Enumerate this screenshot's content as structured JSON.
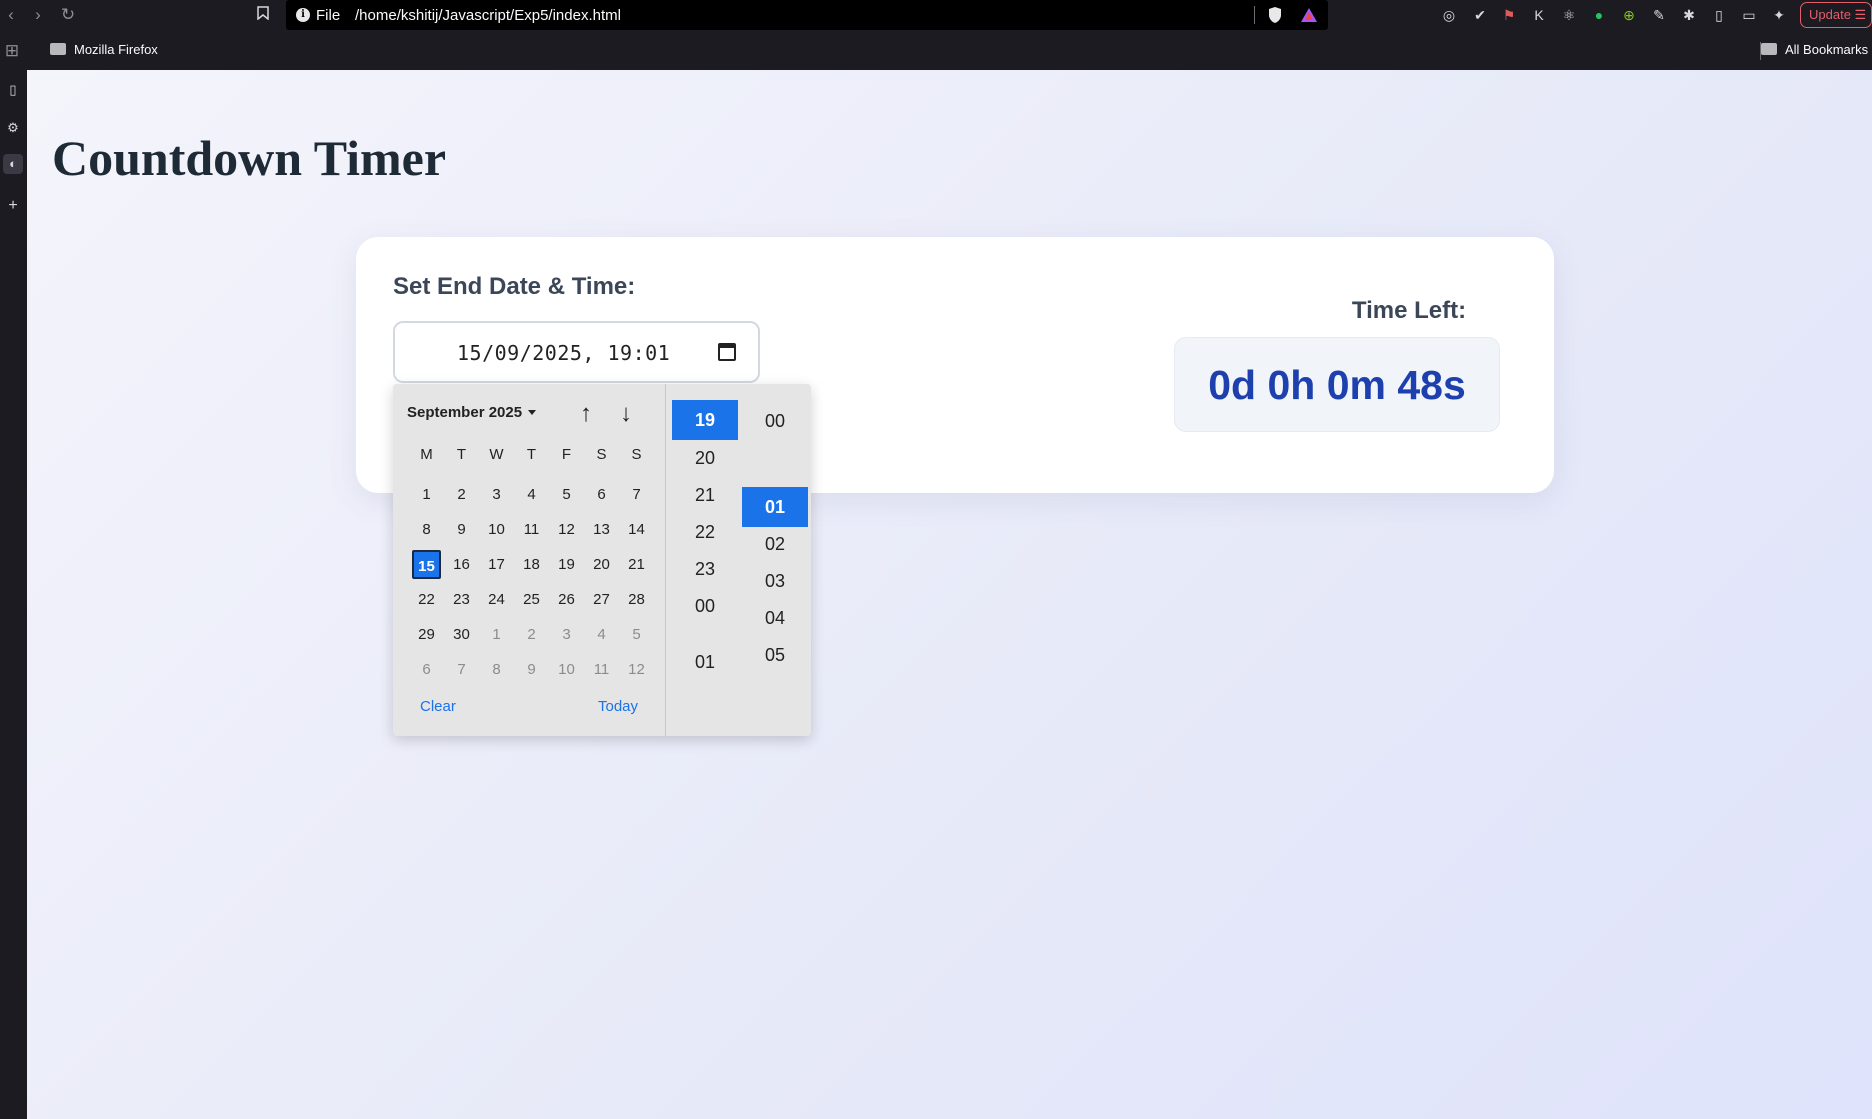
{
  "browser": {
    "url_scheme": "File",
    "url": "/home/kshitij/Javascript/Exp5/index.html",
    "update_label": "Update",
    "bookmarks": [
      {
        "label": "Mozilla Firefox"
      },
      {
        "label": "All Bookmarks"
      }
    ]
  },
  "page": {
    "title": "Countdown Timer"
  },
  "form": {
    "label": "Set End Date & Time:",
    "datetime_value": "15/09/2025, 19:01"
  },
  "timer": {
    "label": "Time Left:",
    "value": "0d 0h 0m 48s"
  },
  "picker": {
    "month_label": "September 2025",
    "weekdays": [
      "M",
      "T",
      "W",
      "T",
      "F",
      "S",
      "S"
    ],
    "days": [
      {
        "d": "1",
        "m": false
      },
      {
        "d": "2",
        "m": false
      },
      {
        "d": "3",
        "m": false
      },
      {
        "d": "4",
        "m": false
      },
      {
        "d": "5",
        "m": false
      },
      {
        "d": "6",
        "m": false
      },
      {
        "d": "7",
        "m": false
      },
      {
        "d": "8",
        "m": false
      },
      {
        "d": "9",
        "m": false
      },
      {
        "d": "10",
        "m": false
      },
      {
        "d": "11",
        "m": false
      },
      {
        "d": "12",
        "m": false
      },
      {
        "d": "13",
        "m": false
      },
      {
        "d": "14",
        "m": false
      },
      {
        "d": "15",
        "m": false,
        "selected": true
      },
      {
        "d": "16",
        "m": false
      },
      {
        "d": "17",
        "m": false
      },
      {
        "d": "18",
        "m": false
      },
      {
        "d": "19",
        "m": false
      },
      {
        "d": "20",
        "m": false
      },
      {
        "d": "21",
        "m": false
      },
      {
        "d": "22",
        "m": false
      },
      {
        "d": "23",
        "m": false
      },
      {
        "d": "24",
        "m": false
      },
      {
        "d": "25",
        "m": false
      },
      {
        "d": "26",
        "m": false
      },
      {
        "d": "27",
        "m": false
      },
      {
        "d": "28",
        "m": false
      },
      {
        "d": "29",
        "m": false
      },
      {
        "d": "30",
        "m": false
      },
      {
        "d": "1",
        "m": true
      },
      {
        "d": "2",
        "m": true
      },
      {
        "d": "3",
        "m": true
      },
      {
        "d": "4",
        "m": true
      },
      {
        "d": "5",
        "m": true
      },
      {
        "d": "6",
        "m": true
      },
      {
        "d": "7",
        "m": true
      },
      {
        "d": "8",
        "m": true
      },
      {
        "d": "9",
        "m": true
      },
      {
        "d": "10",
        "m": true
      },
      {
        "d": "11",
        "m": true
      },
      {
        "d": "12",
        "m": true
      }
    ],
    "clear_label": "Clear",
    "today_label": "Today",
    "hours": [
      "19",
      "20",
      "21",
      "22",
      "23",
      "00",
      "01"
    ],
    "selected_hour": "19",
    "minutes": [
      "00",
      "01",
      "02",
      "03",
      "04",
      "05"
    ],
    "selected_minute": "01"
  },
  "colors": {
    "accent": "#1a73e8",
    "timer_text": "#1e40af",
    "title_text": "#1f2a37"
  }
}
